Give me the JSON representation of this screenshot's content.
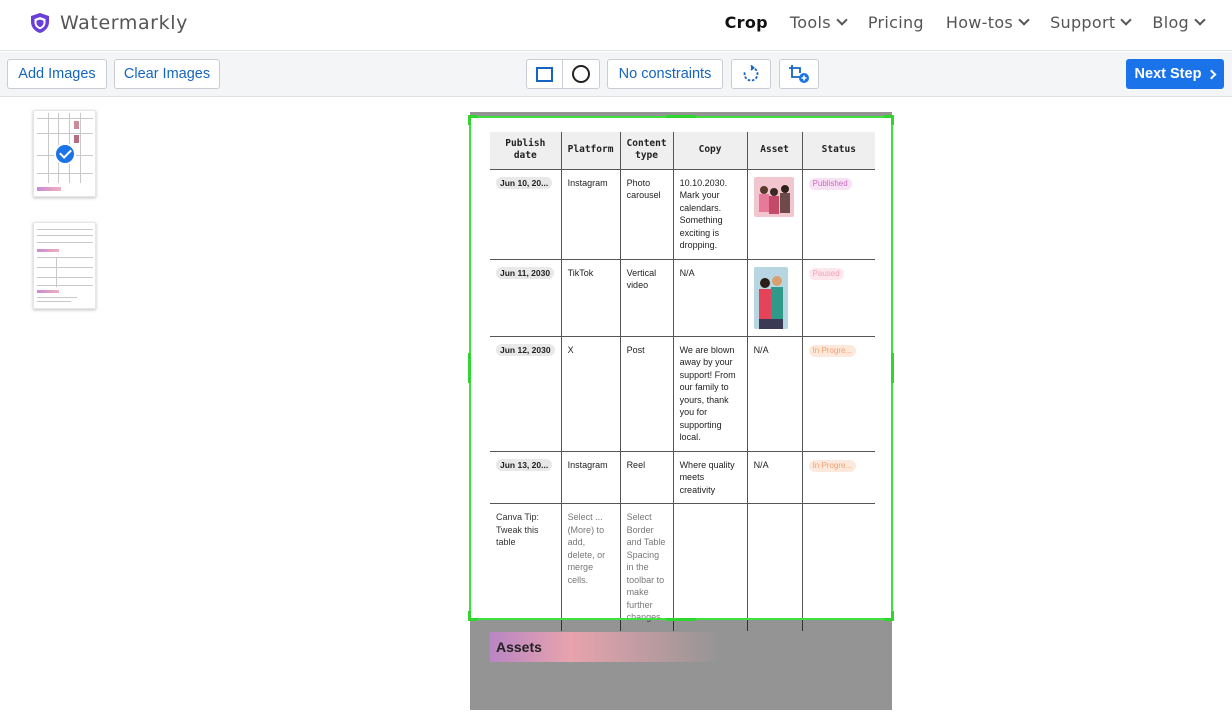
{
  "header": {
    "brand": "Watermarkly",
    "nav": [
      {
        "label": "Crop",
        "active": true,
        "dropdown": false
      },
      {
        "label": "Tools",
        "active": false,
        "dropdown": true
      },
      {
        "label": "Pricing",
        "active": false,
        "dropdown": false
      },
      {
        "label": "How-tos",
        "active": false,
        "dropdown": true
      },
      {
        "label": "Support",
        "active": false,
        "dropdown": true
      },
      {
        "label": "Blog",
        "active": false,
        "dropdown": true
      }
    ]
  },
  "toolbar": {
    "add_images": "Add Images",
    "clear_images": "Clear Images",
    "constraints": "No constraints",
    "next_step": "Next Step",
    "shape_selected": "rectangle"
  },
  "thumbnails": [
    {
      "selected": true
    },
    {
      "selected": false
    }
  ],
  "document": {
    "table": {
      "headers": [
        "Publish date",
        "Platform",
        "Content type",
        "Copy",
        "Asset",
        "Status"
      ],
      "rows": [
        {
          "date": "Jun 10, 20...",
          "platform": "Instagram",
          "type": "Photo carousel",
          "copy": "10.10.2030. Mark your calendars. Something exciting is dropping.",
          "asset": "image",
          "status": "Published",
          "status_kind": "published"
        },
        {
          "date": "Jun 11, 2030",
          "platform": "TikTok",
          "type": "Vertical video",
          "copy": "N/A",
          "asset": "image",
          "status": "Paused",
          "status_kind": "paused"
        },
        {
          "date": "Jun 12, 2030",
          "platform": "X",
          "type": "Post",
          "copy": "We are blown away by your support! From our family to yours, thank you for supporting local.",
          "asset": "N/A",
          "status": "In Progre...",
          "status_kind": "progress"
        },
        {
          "date": "Jun 13, 20...",
          "platform": "Instagram",
          "type": "Reel",
          "copy": "Where quality meets creativity",
          "asset": "N/A",
          "status": "In Progre...",
          "status_kind": "progress"
        }
      ],
      "tip_row": {
        "c1": "Canva Tip: Tweak this table",
        "c2": "Select ... (More) to add, delete, or merge cells.",
        "c3": "Select Border and Table Spacing in the toolbar to make further changes."
      }
    },
    "assets_heading": "Assets"
  },
  "colors": {
    "accent": "#1a73e8",
    "crop_frame": "#3ee23e",
    "brand_shield": "#6a3fd8"
  }
}
